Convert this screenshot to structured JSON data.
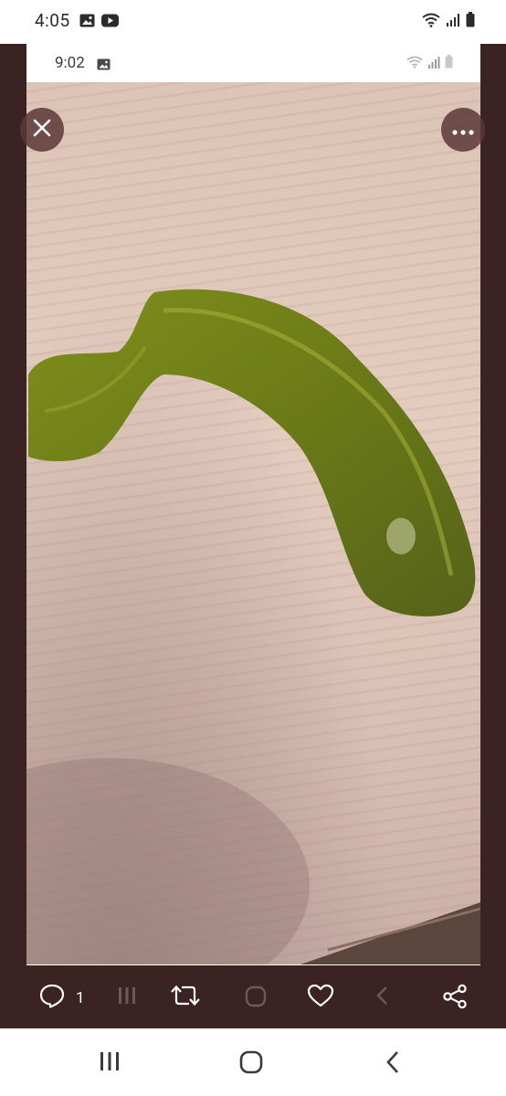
{
  "status_bar": {
    "time": "4:05",
    "icons": [
      "gallery-icon",
      "youtube-icon",
      "wifi-icon",
      "signal-icon",
      "battery-icon"
    ]
  },
  "embedded_screenshot": {
    "time": "9:02",
    "icons": [
      "gallery-icon",
      "wifi-icon",
      "signal-icon",
      "battery-icon"
    ]
  },
  "viewer": {
    "close_icon": "close-icon",
    "more_icon": "more-options-icon",
    "background_color": "#3b2323"
  },
  "actions": {
    "reply_count": "1",
    "reply_icon": "comment-icon",
    "retweet_icon": "retweet-icon",
    "like_icon": "heart-icon",
    "share_icon": "share-icon"
  },
  "nav_bar": {
    "recents_icon": "recents-icon",
    "home_icon": "home-icon",
    "back_icon": "back-icon"
  }
}
